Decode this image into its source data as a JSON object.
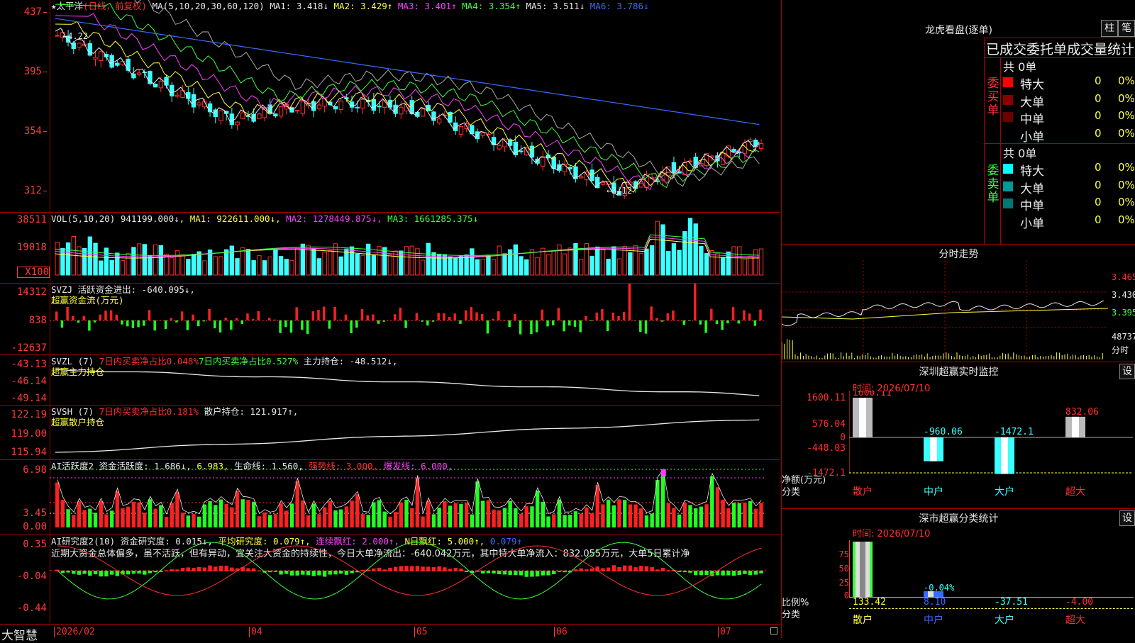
{
  "main": {
    "stock_name": "★太平洋",
    "period": "(日线，前复权)",
    "ma_label": "MA(5,10,20,30,60,120)",
    "ma_values": [
      {
        "text": "MA1: 3.418↓",
        "color": "#e8e8e8"
      },
      {
        "text": "MA2: 3.429↑",
        "color": "#ffff3c"
      },
      {
        "text": "MA3: 3.401↑",
        "color": "#ff40ff"
      },
      {
        "text": "MA4: 3.354↑",
        "color": "#3cff3c"
      },
      {
        "text": "MA5: 3.511↓",
        "color": "#e8e8e8"
      },
      {
        "text": "MA6: 3.786↓",
        "color": "#3a6bff"
      }
    ],
    "y_ticks": [
      "437",
      "395",
      "354",
      "312"
    ],
    "high_label": "4.22",
    "low_label": "3.12"
  },
  "vol": {
    "label": "VOL(5,10,20)",
    "value": "941199.000↓,",
    "ma": [
      {
        "text": "MA1: 922611.000↓,",
        "color": "#ffff3c"
      },
      {
        "text": "MA2: 1278449.875↓,",
        "color": "#ff40ff"
      },
      {
        "text": "MA3: 1661285.375↓",
        "color": "#3cff3c"
      }
    ],
    "y_ticks": [
      "38511",
      "19018"
    ],
    "unit": "X100"
  },
  "svzj": {
    "label": "SVZJ  活跃资金进出: -640.095↓,",
    "sub": "超赢资金流(万元)",
    "y_ticks": [
      "14312",
      "838",
      "-12637"
    ]
  },
  "svzl": {
    "label": "SVZL (7)",
    "red": "7日内买卖净占比0.048%",
    "green": "7日内买卖净占比0.527%",
    "white": "主力持仓: -48.512↓,",
    "sub": "超赢主力持仓",
    "y_ticks": [
      "-43.13",
      "-46.14",
      "-49.14"
    ]
  },
  "svsh": {
    "label": "SVSH (7)",
    "red": "7日内买卖净占比0.181%",
    "white": "散户持仓: 121.917↑,",
    "sub": "超赢散户持仓",
    "y_ticks": [
      "122.19",
      "119.00",
      "115.94"
    ]
  },
  "ai_active": {
    "label": "AI活跃度2 资金活跃度: 1.686↓,",
    "v2": "6.983,",
    "life": "生命线: 1.560,",
    "strong": "强势线: 3.000,",
    "burst": "爆发线: 6.000,",
    "y_ticks": [
      "6.98",
      "3.45",
      "0.00"
    ]
  },
  "ai_research": {
    "label": "AI研究度2(10) 资金研究度: 0.015↓,",
    "avg": "平均研究度: 0.079↑,",
    "cont": "连续飘红: 2.000↑,",
    "nday": "N日飘红: 5.000↑,",
    "last": "0.079↑",
    "commentary": "近期大资金总体偏多，虽不活跃，但有异动，宜关注大资金的持续性，今日大单净流出：-640.042万元，其中特大单净流入：832.055万元，大单5日累计净",
    "y_ticks": [
      "0.35",
      "-0.04",
      "-0.44"
    ]
  },
  "xaxis": {
    "logo": "大智慧",
    "months": [
      "2026/02",
      "04",
      "05",
      "06",
      "07"
    ]
  },
  "longhu": {
    "title": "龙虎看盘(逐单)",
    "btn1": "柱",
    "btn2": "笔",
    "subtitle": "已成交委托单成交量统计",
    "buy": {
      "side": "委买单",
      "total": "共 0单",
      "rows": [
        {
          "name": "特大",
          "qty": "0",
          "pct": "0%",
          "color": "#ff0000"
        },
        {
          "name": "大单",
          "qty": "0",
          "pct": "0%",
          "color": "#8b0000"
        },
        {
          "name": "中单",
          "qty": "0",
          "pct": "0%",
          "color": "#6b0000"
        },
        {
          "name": "小单",
          "qty": "0",
          "pct": "0%",
          "color": "#000000"
        }
      ]
    },
    "sell": {
      "side": "委卖单",
      "total": "共 0单",
      "rows": [
        {
          "name": "特大",
          "qty": "0",
          "pct": "0%",
          "color": "#00ffff"
        },
        {
          "name": "大单",
          "qty": "0",
          "pct": "0%",
          "color": "#009999"
        },
        {
          "name": "中单",
          "qty": "0",
          "pct": "0%",
          "color": "#007777"
        },
        {
          "name": "小单",
          "qty": "0",
          "pct": "0%",
          "color": "#000000"
        }
      ]
    }
  },
  "intraday": {
    "title": "分时走势",
    "prices": [
      "3.465",
      "3.430",
      "3.395"
    ],
    "vol": "48737",
    "vol_label": "分时"
  },
  "monitor": {
    "title": "深圳超赢实时监控",
    "set": "设",
    "time": "时间: 2026/07/10",
    "y_ticks": [
      "1600.11",
      "576.04",
      "0",
      "-448.03",
      "-1472.1"
    ],
    "ylabel1": "净额(万元)",
    "ylabel2": "分类",
    "bars": [
      {
        "cat": "散户",
        "value": 1600.11,
        "label": "1600.11"
      },
      {
        "cat": "中户",
        "value": -960.06,
        "label": "-960.06"
      },
      {
        "cat": "大户",
        "value": -1472.1,
        "label": "-1472.1"
      },
      {
        "cat": "超大",
        "value": 832.06,
        "label": "832.06"
      }
    ]
  },
  "classify": {
    "title": "深市超赢分类统计",
    "set": "设",
    "time": "时间: 2026/07/10",
    "y_ticks": [
      "75",
      "50",
      "25",
      "0"
    ],
    "ylabel1": "比例%",
    "ylabel2": "分类",
    "pct_label": "-0.04%",
    "cats": [
      "散户",
      "中户",
      "大户",
      "超大"
    ],
    "values": [
      "133.42",
      "8.10",
      "-37.51",
      "-4.00"
    ]
  }
}
